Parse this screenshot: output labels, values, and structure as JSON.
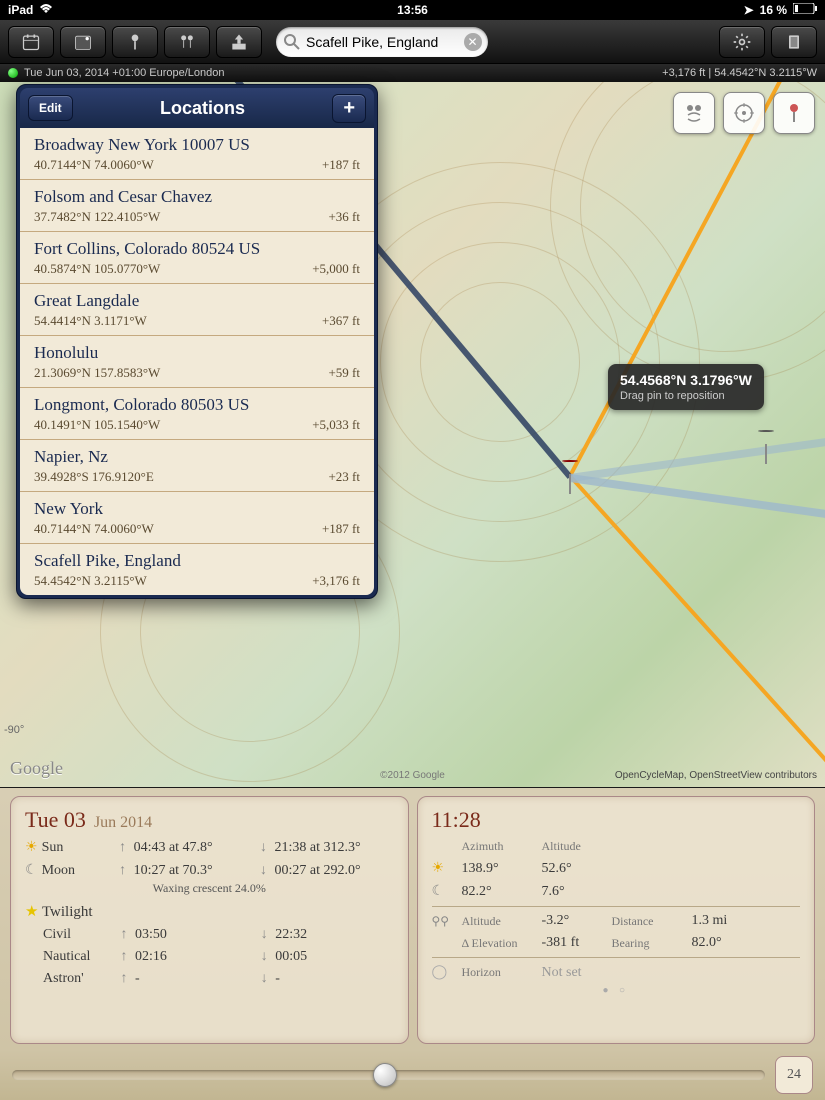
{
  "status": {
    "device": "iPad",
    "time": "13:56",
    "battery": "16 %"
  },
  "toolbar": {
    "search_value": "Scafell Pike, England"
  },
  "info_strip": {
    "left": "Tue Jun 03, 2014 +01:00 Europe/London",
    "right": "+3,176 ft | 54.4542°N 3.2115°W"
  },
  "popover": {
    "edit": "Edit",
    "title": "Locations",
    "items": [
      {
        "name": "Broadway New York 10007 US",
        "coord": "40.7144°N 74.0060°W",
        "elev": "+187 ft"
      },
      {
        "name": "Folsom and Cesar Chavez",
        "coord": "37.7482°N 122.4105°W",
        "elev": "+36 ft"
      },
      {
        "name": "Fort Collins, Colorado 80524 US",
        "coord": "40.5874°N 105.0770°W",
        "elev": "+5,000 ft"
      },
      {
        "name": "Great Langdale",
        "coord": "54.4414°N 3.1171°W",
        "elev": "+367 ft"
      },
      {
        "name": "Honolulu",
        "coord": "21.3069°N 157.8583°W",
        "elev": "+59 ft"
      },
      {
        "name": "Longmont, Colorado 80503 US",
        "coord": "40.1491°N 105.1540°W",
        "elev": "+5,033 ft"
      },
      {
        "name": "Napier, Nz",
        "coord": "39.4928°S 176.9120°E",
        "elev": "+23 ft"
      },
      {
        "name": "New York",
        "coord": "40.7144°N 74.0060°W",
        "elev": "+187 ft"
      },
      {
        "name": "Scafell Pike, England",
        "coord": "54.4542°N 3.2115°W",
        "elev": "+3,176 ft"
      }
    ]
  },
  "map": {
    "tooltip_coord": "54.4568°N 3.1796°W",
    "tooltip_hint": "Drag pin to reposition",
    "google": "Google",
    "copyright": "©2012 Google",
    "attribution": "OpenCycleMap, OpenStreetView contributors",
    "deg_label": "-90°"
  },
  "left_panel": {
    "day": "Tue 03",
    "month": "Jun 2014",
    "sun_label": "Sun",
    "sun_rise": "04:43 at 47.8°",
    "sun_set": "21:38 at 312.3°",
    "moon_label": "Moon",
    "moon_rise": "10:27 at 70.3°",
    "moon_set": "00:27 at 292.0°",
    "phase": "Waxing crescent 24.0%",
    "twilight_label": "Twilight",
    "civil_l": "Civil",
    "civil_r": "03:50",
    "civil_s": "22:32",
    "naut_l": "Nautical",
    "naut_r": "02:16",
    "naut_s": "00:05",
    "astr_l": "Astron'",
    "astr_r": "-",
    "astr_s": "-"
  },
  "right_panel": {
    "time": "11:28",
    "az_h": "Azimuth",
    "alt_h": "Altitude",
    "sun_az": "138.9°",
    "sun_alt": "52.6°",
    "moon_az": "82.2°",
    "moon_alt": "7.6°",
    "pin_alt_h": "Altitude",
    "pin_alt": "-3.2°",
    "dist_h": "Distance",
    "dist": "1.3 mi",
    "delev_h": "Δ Elevation",
    "delev": "-381 ft",
    "bear_h": "Bearing",
    "bear": "82.0°",
    "hor_h": "Horizon",
    "hor": "Not set"
  },
  "slider": {
    "btn": "24"
  }
}
